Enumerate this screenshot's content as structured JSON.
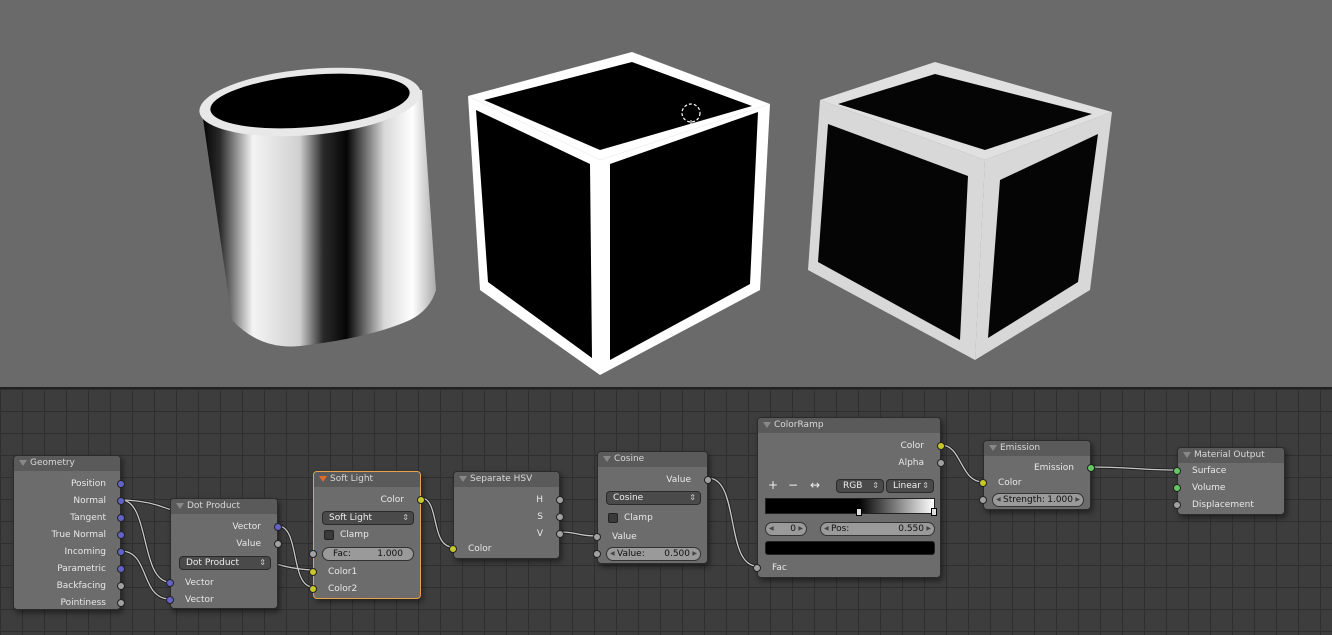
{
  "viewport": {
    "background": "#6a6a6a",
    "objects": [
      "cylinder",
      "cube-sharp",
      "cube-soft"
    ]
  },
  "nodes": {
    "geometry": {
      "title": "Geometry",
      "outputs": [
        "Position",
        "Normal",
        "Tangent",
        "True Normal",
        "Incoming",
        "Parametric",
        "Backfacing",
        "Pointiness"
      ]
    },
    "dot_product": {
      "title": "Dot Product",
      "outputs": [
        "Vector",
        "Value"
      ],
      "operation": "Dot Product",
      "inputs": [
        "Vector",
        "Vector"
      ]
    },
    "soft_light": {
      "title": "Soft Light",
      "output": "Color",
      "blend_mode": "Soft Light",
      "clamp_label": "Clamp",
      "fac_label": "Fac:",
      "fac_value": "1.000",
      "inputs": [
        "Color1",
        "Color2"
      ]
    },
    "separate_hsv": {
      "title": "Separate HSV",
      "outputs": [
        "H",
        "S",
        "V"
      ],
      "input": "Color"
    },
    "cosine": {
      "title": "Cosine",
      "output": "Value",
      "operation": "Cosine",
      "clamp_label": "Clamp",
      "input_label": "Value",
      "value_label": "Value:",
      "value": "0.500"
    },
    "colorramp": {
      "title": "ColorRamp",
      "outputs": [
        "Color",
        "Alpha"
      ],
      "plus": "+",
      "minus": "−",
      "flip": "↔",
      "color_mode": "RGB",
      "interpolation": "Linear",
      "index": "0",
      "pos_label": "Pos:",
      "pos_value": "0.550",
      "input": "Fac"
    },
    "emission": {
      "title": "Emission",
      "output": "Emission",
      "input_color": "Color",
      "strength_label": "Strength:",
      "strength_value": "1.000"
    },
    "material_output": {
      "title": "Material Output",
      "inputs": [
        "Surface",
        "Volume",
        "Displacement"
      ]
    }
  },
  "colors": {
    "socket_vector": "#6363c7",
    "socket_color": "#c7c729",
    "socket_value": "#a1a1a1",
    "socket_shader": "#63c763",
    "active_border": "#e3a44a"
  }
}
